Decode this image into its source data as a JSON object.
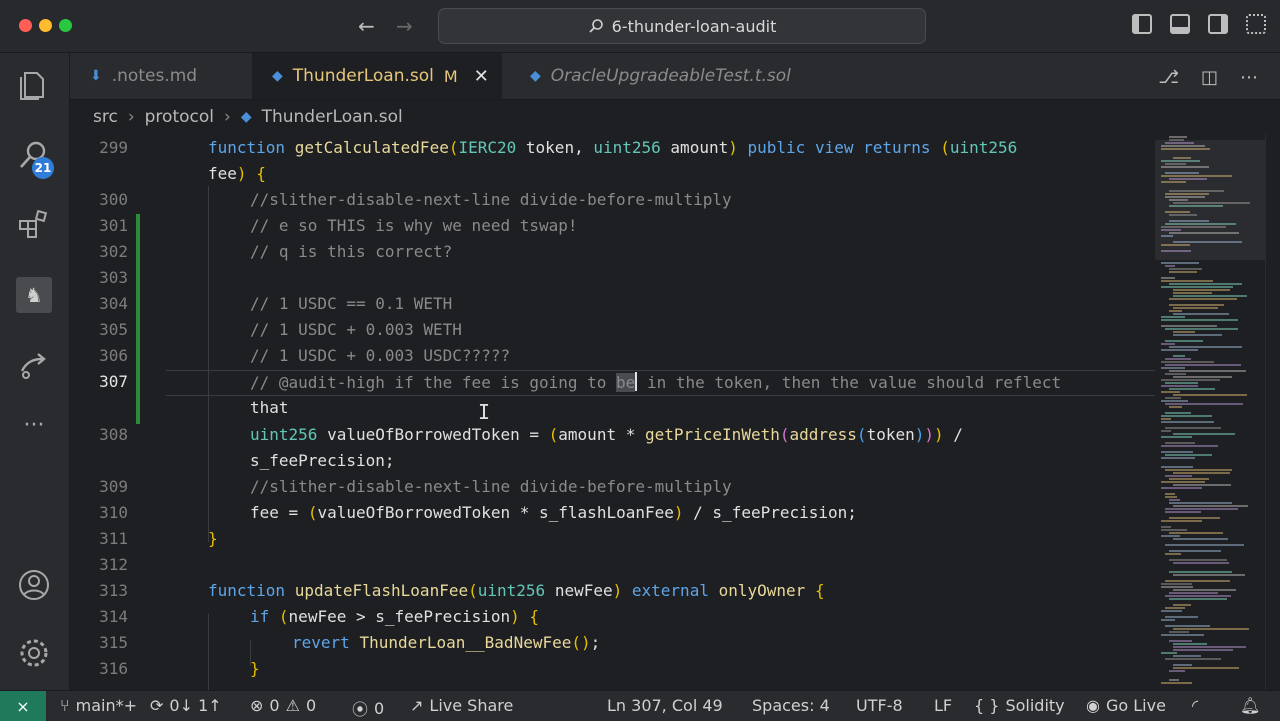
{
  "window": {
    "title": "6-thunder-loan-audit"
  },
  "activity": {
    "search_badge": "21",
    "more": "···"
  },
  "tabs": [
    {
      "label": ".notes.md",
      "active": false
    },
    {
      "label": "ThunderLoan.sol",
      "modified": "M",
      "close": "✕",
      "active": true
    },
    {
      "label": "OracleUpgradeableTest.t.sol",
      "active": false
    }
  ],
  "breadcrumb": [
    "src",
    "protocol",
    "ThunderLoan.sol"
  ],
  "editor": {
    "cursor_line": 307,
    "lines": [
      {
        "num": "299",
        "text": "function getCalculatedFee(IERC20 token, uint256 amount) public view returns (uint256"
      },
      {
        "num": "",
        "text": "fee) {"
      },
      {
        "num": "300",
        "text": "//slither-disable-next-line divide-before-multiply"
      },
      {
        "num": "301",
        "text": "// e so THIS is why we need tswap!"
      },
      {
        "num": "302",
        "text": "// q is this correct?"
      },
      {
        "num": "303",
        "text": ""
      },
      {
        "num": "304",
        "text": "// 1 USDC == 0.1 WETH"
      },
      {
        "num": "305",
        "text": "// 1 USDC + 0.003 WETH"
      },
      {
        "num": "306",
        "text": "// 1 USDC + 0.003 USDC?????"
      },
      {
        "num": "307",
        "text": "// @audit-high if the fee is going to be in the token, then the value should reflect"
      },
      {
        "num": "",
        "text": "that"
      },
      {
        "num": "308",
        "text": "uint256 valueOfBorrowedToken = (amount * getPriceInWeth(address(token))) /"
      },
      {
        "num": "",
        "text": "s_feePrecision;"
      },
      {
        "num": "309",
        "text": "//slither-disable-next-line divide-before-multiply"
      },
      {
        "num": "310",
        "text": "fee = (valueOfBorrowedToken * s_flashLoanFee) / s_feePrecision;"
      },
      {
        "num": "311",
        "text": "}"
      },
      {
        "num": "312",
        "text": ""
      },
      {
        "num": "313",
        "text": "function updateFlashLoanFee(uint256 newFee) external onlyOwner {"
      },
      {
        "num": "314",
        "text": "if (newFee > s_feePrecision) {"
      },
      {
        "num": "315",
        "text": "revert ThunderLoan__BadNewFee();"
      },
      {
        "num": "316",
        "text": "}"
      }
    ]
  },
  "statusbar": {
    "branch": "main*+",
    "sync": "0↓ 1↑",
    "errors": "0",
    "warnings": "0",
    "ports": "0",
    "live_share": "Live Share",
    "position": "Ln 307, Col 49",
    "spaces": "Spaces: 4",
    "encoding": "UTF-8",
    "eol": "LF",
    "language": "Solidity",
    "go_live": "Go Live"
  },
  "colors": {
    "accent_blue": "#2f7dd8",
    "remote_green": "#1e7a5a",
    "diff_added": "#2d8a3a",
    "modified_tab": "#e6c77a"
  }
}
